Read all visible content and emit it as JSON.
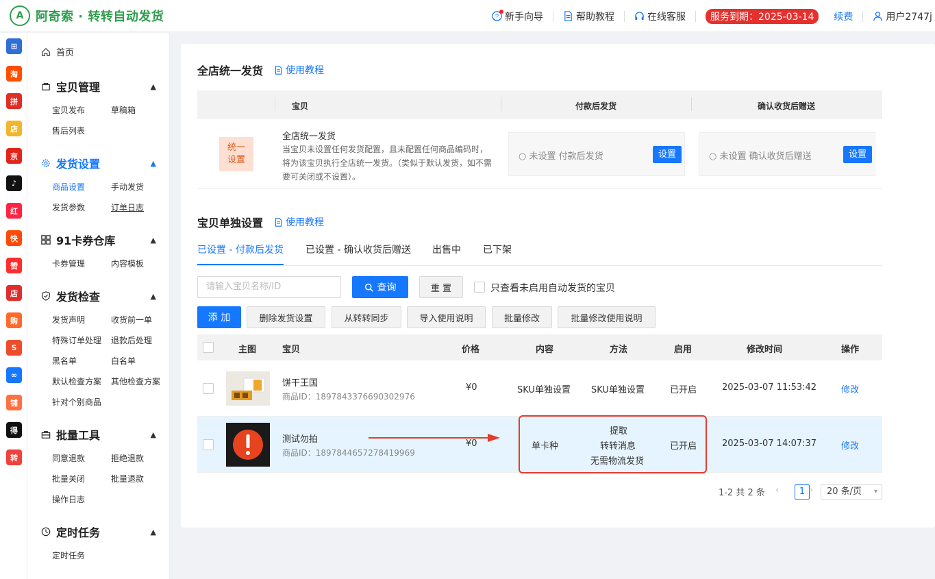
{
  "app": {
    "title": "阿奇索 · 转转自动发货",
    "logo_glyph": "A",
    "brand_color": "#2e9e4d",
    "accent_color": "#1677ff"
  },
  "header": {
    "guide": "新手向导",
    "help": "帮助教程",
    "service": "在线客服",
    "expire": "服务到期：2025-03-14",
    "renew": "续费",
    "user": "用户2747j"
  },
  "rail": [
    {
      "name": "apps-grid-icon",
      "glyph": "⊞",
      "color": "#2f6fd6"
    },
    {
      "name": "taobao-icon",
      "glyph": "淘",
      "color": "#ff5000"
    },
    {
      "name": "pinduoduo-icon",
      "glyph": "拼",
      "color": "#e02e24"
    },
    {
      "name": "douyin-shop-icon",
      "glyph": "店",
      "color": "#f3b52c"
    },
    {
      "name": "jd-icon",
      "glyph": "京",
      "color": "#e1251b"
    },
    {
      "name": "tiktok-icon",
      "glyph": "♪",
      "color": "#111111"
    },
    {
      "name": "xiaohongshu-icon",
      "glyph": "红",
      "color": "#ff2442"
    },
    {
      "name": "kuaishou-icon",
      "glyph": "快",
      "color": "#ff4906"
    },
    {
      "name": "thumb-icon",
      "glyph": "赞",
      "color": "#ff2d2d"
    },
    {
      "name": "weidian-icon",
      "glyph": "店",
      "color": "#e02d2d"
    },
    {
      "name": "shop-bag-icon",
      "glyph": "购",
      "color": "#ff6a2a"
    },
    {
      "name": "shopee-icon",
      "glyph": "S",
      "color": "#ee4d2d"
    },
    {
      "name": "link-icon",
      "glyph": "∞",
      "color": "#1677ff"
    },
    {
      "name": "store-icon",
      "glyph": "铺",
      "color": "#ff7043"
    },
    {
      "name": "dewu-icon",
      "glyph": "得",
      "color": "#111111"
    },
    {
      "name": "zhuanzhuan-icon",
      "glyph": "转",
      "color": "#f0413a"
    }
  ],
  "sidebar": {
    "home": "首页",
    "groups": [
      {
        "title": "宝贝管理",
        "items": [
          "宝贝发布",
          "草稿箱",
          "售后列表"
        ]
      },
      {
        "title": "发货设置",
        "items": [
          "商品设置",
          "手动发货",
          "发货参数",
          "订单日志"
        ]
      },
      {
        "title": "91卡券仓库",
        "items": [
          "卡券管理",
          "内容模板"
        ]
      },
      {
        "title": "发货检查",
        "items": [
          "发货声明",
          "收货前一单",
          "特殊订单处理",
          "退款后处理",
          "黑名单",
          "白名单",
          "默认检查方案",
          "其他检查方案",
          "针对个别商品"
        ]
      },
      {
        "title": "批量工具",
        "items": [
          "同意退款",
          "拒绝退款",
          "批量关闭",
          "批量退款",
          "操作日志"
        ]
      },
      {
        "title": "定时任务",
        "items": [
          "定时任务"
        ]
      }
    ]
  },
  "uniform": {
    "title": "全店统一发货",
    "tutorial": "使用教程",
    "head": {
      "item": "宝贝",
      "after_pay": "付款后发货",
      "after_confirm": "确认收货后赠送"
    },
    "badge_line1": "统一",
    "badge_line2": "设置",
    "name": "全店统一发货",
    "desc": "当宝贝未设置任何发货配置，且未配置任何商品编码时，将为该宝贝执行全店统一发货。（类似于默认发货，如不需要可关闭或不设置）。",
    "pay_status": "○ 未设置 付款后发货",
    "confirm_status": "○ 未设置 确认收货后赠送",
    "set_btn": "设置"
  },
  "individual": {
    "title": "宝贝单独设置",
    "tutorial": "使用教程",
    "tabs": [
      "已设置 - 付款后发货",
      "已设置 - 确认收货后赠送",
      "出售中",
      "已下架"
    ],
    "search_placeholder": "请输入宝贝名称/ID",
    "query": "查询",
    "reset": "重 置",
    "only_unenabled": "只查看未启用自动发货的宝贝",
    "add": "添 加",
    "actions": [
      "删除发货设置",
      "从转转同步",
      "导入使用说明",
      "批量修改",
      "批量修改使用说明"
    ],
    "columns": {
      "image": "主图",
      "item": "宝贝",
      "price": "价格",
      "content": "内容",
      "method": "方法",
      "enabled": "启用",
      "modified": "修改时间",
      "op": "操作"
    },
    "rows": [
      {
        "name": "饼干王国",
        "pid": "商品ID：1897843376690302976",
        "price": "¥0",
        "content": "SKU单独设置",
        "method": [
          "SKU单独设置"
        ],
        "enabled": "已开启",
        "modified": "2025-03-07 11:53:42",
        "op": "修改"
      },
      {
        "name": "测试勿拍",
        "pid": "商品ID：1897844657278419969",
        "price": "¥0",
        "content": "单卡种",
        "method": [
          "提取",
          "转转消息",
          "无需物流发货"
        ],
        "enabled": "已开启",
        "modified": "2025-03-07 14:07:37",
        "op": "修改"
      }
    ],
    "pager": {
      "total": "1-2 共 2 条",
      "page": "1",
      "size": "20 条/页"
    }
  }
}
